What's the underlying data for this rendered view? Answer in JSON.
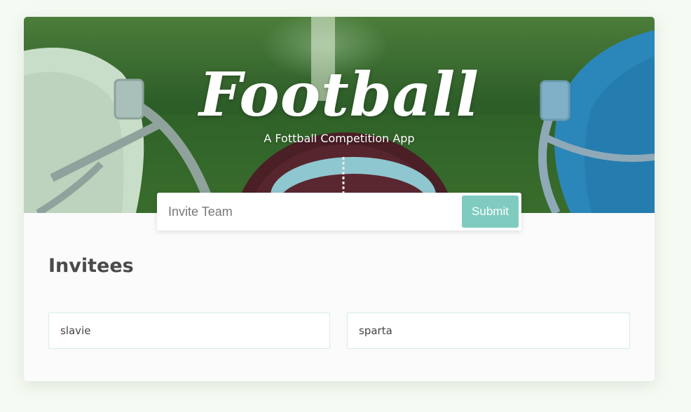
{
  "hero": {
    "title": "Football",
    "subtitle": "A Fottball Competition App"
  },
  "invite": {
    "placeholder": "Invite Team",
    "value": "",
    "submit_label": "Submit"
  },
  "invitees": {
    "heading": "Invitees",
    "items": [
      "slavie",
      "sparta"
    ]
  },
  "colors": {
    "accent": "#7fcbbf",
    "page_background": "#f5faf2",
    "card_background": "#fbfbfb",
    "heading_text": "#4a4a4a"
  },
  "icons": {
    "hero_image": "football-helmets-image"
  }
}
